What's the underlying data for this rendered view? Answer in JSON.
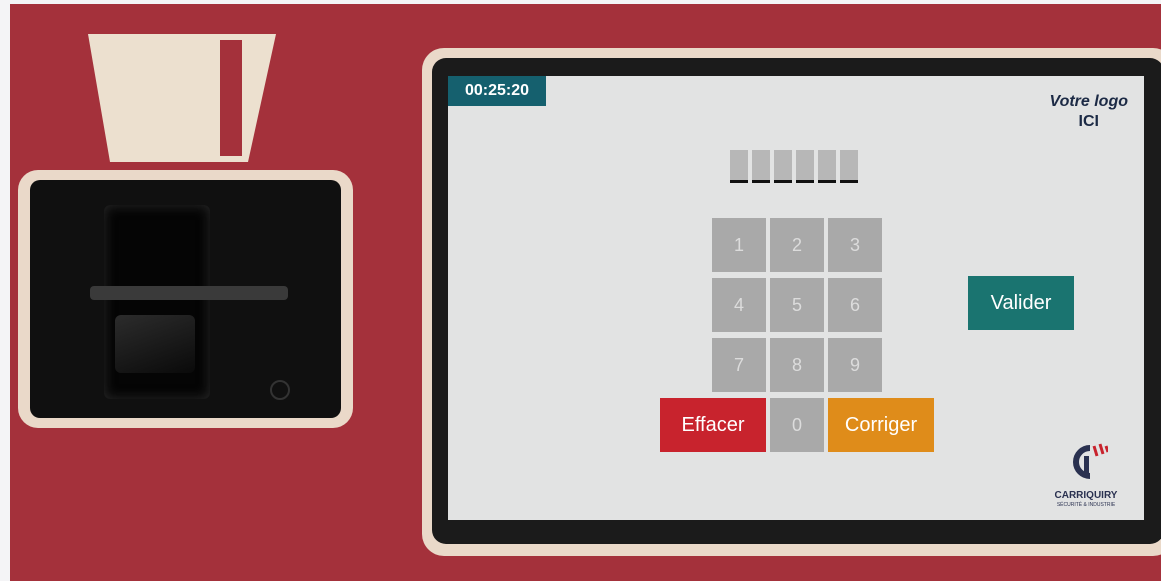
{
  "timer": "00:25:20",
  "logo": {
    "line1": "Votre logo",
    "line2": "ICI"
  },
  "pin": {
    "slots": 6
  },
  "keypad": {
    "keys": [
      "1",
      "2",
      "3",
      "4",
      "5",
      "6",
      "7",
      "8",
      "9"
    ],
    "zero": "0",
    "clear_label": "Effacer",
    "correct_label": "Corriger"
  },
  "validate_label": "Valider",
  "brand": {
    "name": "CARRIQUIRY",
    "tagline": "SÉCURITÉ & INDUSTRIE"
  },
  "colors": {
    "panel": "#a4313b",
    "timer_bg": "#15606e",
    "clear": "#c8232d",
    "correct": "#df8c1a",
    "validate": "#1a7470"
  }
}
